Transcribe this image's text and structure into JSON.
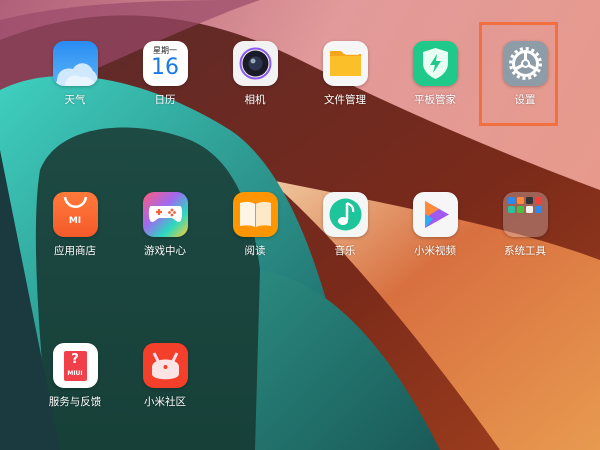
{
  "home_screen": {
    "apps": [
      {
        "id": "weather",
        "label": "天气",
        "icon": "weather-cloud-icon"
      },
      {
        "id": "calendar",
        "label": "日历",
        "icon": "calendar-icon",
        "weekday": "星期一",
        "day": "16"
      },
      {
        "id": "camera",
        "label": "相机",
        "icon": "camera-icon"
      },
      {
        "id": "file-manager",
        "label": "文件管理",
        "icon": "folder-icon"
      },
      {
        "id": "security",
        "label": "平板管家",
        "icon": "shield-bolt-icon"
      },
      {
        "id": "settings",
        "label": "设置",
        "icon": "gear-icon"
      },
      {
        "id": "app-store",
        "label": "应用商店",
        "icon": "shopping-bag-icon",
        "badge_text": "MI"
      },
      {
        "id": "game-center",
        "label": "游戏中心",
        "icon": "gamepad-icon"
      },
      {
        "id": "reader",
        "label": "阅读",
        "icon": "book-icon"
      },
      {
        "id": "music",
        "label": "音乐",
        "icon": "music-note-icon"
      },
      {
        "id": "mi-video",
        "label": "小米视频",
        "icon": "play-icon"
      },
      {
        "id": "system-tools",
        "label": "系统工具",
        "icon": "folder-grid-icon"
      },
      {
        "id": "feedback",
        "label": "服务与反馈",
        "icon": "help-bag-icon",
        "badge_text": "MIUI"
      },
      {
        "id": "mi-community",
        "label": "小米社区",
        "icon": "mi-bunny-icon"
      }
    ],
    "highlight": {
      "target": "settings",
      "color": "#f2703f"
    }
  }
}
